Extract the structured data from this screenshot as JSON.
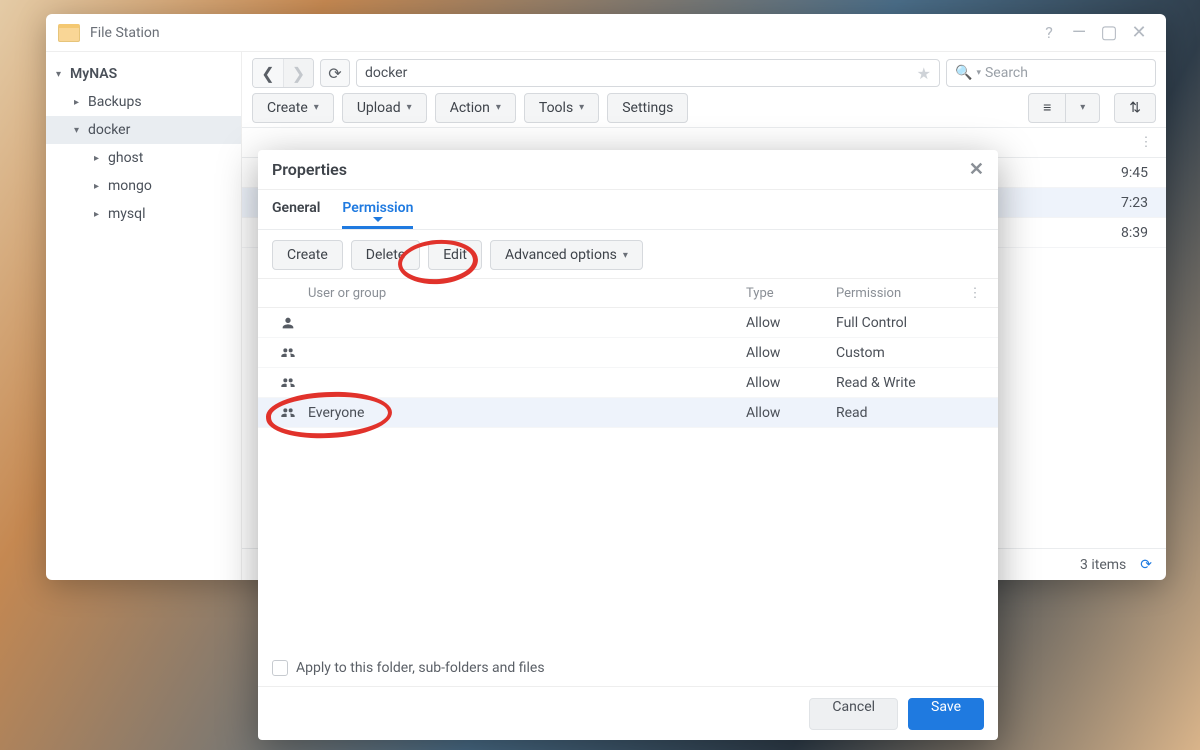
{
  "window": {
    "title": "File Station",
    "controls": {
      "help": "?",
      "minimize": "—",
      "maximize": "▢",
      "close": "✕"
    }
  },
  "sidebar": {
    "root": {
      "label": "MyNAS",
      "expanded": true
    },
    "items": [
      {
        "label": "Backups",
        "depth": 1,
        "expanded": false,
        "selected": false
      },
      {
        "label": "docker",
        "depth": 1,
        "expanded": true,
        "selected": true
      },
      {
        "label": "ghost",
        "depth": 2,
        "expanded": false,
        "selected": false
      },
      {
        "label": "mongo",
        "depth": 2,
        "expanded": false,
        "selected": false
      },
      {
        "label": "mysql",
        "depth": 2,
        "expanded": false,
        "selected": false
      }
    ]
  },
  "toolbar": {
    "path": "docker",
    "search_placeholder": "Search",
    "create": "Create",
    "upload": "Upload",
    "action": "Action",
    "tools": "Tools",
    "settings": "Settings"
  },
  "filelist": {
    "headers": {
      "name": "",
      "size": "",
      "type": "",
      "modified": ""
    },
    "rows": [
      {
        "time_fragment": "9:45",
        "selected": false
      },
      {
        "time_fragment": "7:23",
        "selected": true
      },
      {
        "time_fragment": "8:39",
        "selected": false
      }
    ]
  },
  "statusbar": {
    "items_label": "3 items"
  },
  "dialog": {
    "title": "Properties",
    "tabs": {
      "general": "General",
      "permission": "Permission",
      "active": "permission"
    },
    "toolbar": {
      "create": "Create",
      "delete": "Delete",
      "edit": "Edit",
      "advanced": "Advanced options"
    },
    "columns": {
      "user": "User or group",
      "type": "Type",
      "perm": "Permission"
    },
    "rows": [
      {
        "icon": "person",
        "name": "",
        "type": "Allow",
        "perm": "Full Control",
        "selected": false
      },
      {
        "icon": "group",
        "name": "",
        "type": "Allow",
        "perm": "Custom",
        "selected": false
      },
      {
        "icon": "group",
        "name": "",
        "type": "Allow",
        "perm": "Read & Write",
        "selected": false
      },
      {
        "icon": "group",
        "name": "Everyone",
        "type": "Allow",
        "perm": "Read",
        "selected": true
      }
    ],
    "apply_label": "Apply to this folder, sub-folders and files",
    "cancel": "Cancel",
    "save": "Save"
  }
}
